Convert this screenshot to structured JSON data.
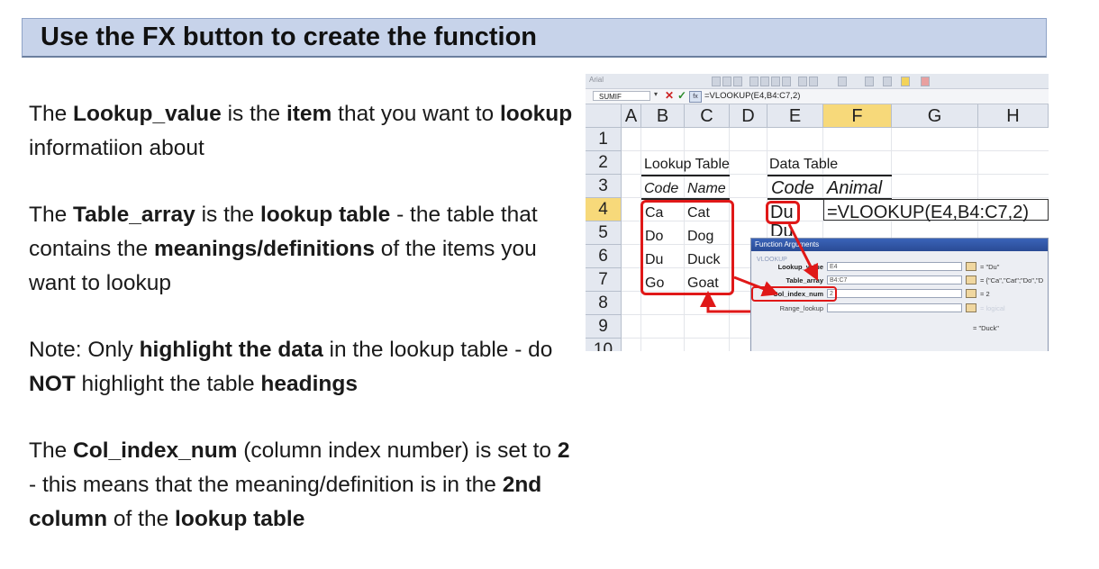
{
  "title": "Use the FX button to create the function",
  "paragraphs": [
    [
      {
        "t": "The ",
        "b": false
      },
      {
        "t": "Lookup_value",
        "b": true
      },
      {
        "t": " is the ",
        "b": false
      },
      {
        "t": "item",
        "b": true
      },
      {
        "t": " that you want to ",
        "b": false
      },
      {
        "t": "lookup",
        "b": true
      },
      {
        "t": " informatiion about",
        "b": false
      }
    ],
    [
      {
        "t": "The ",
        "b": false
      },
      {
        "t": "Table_array",
        "b": true
      },
      {
        "t": " is the ",
        "b": false
      },
      {
        "t": "lookup table",
        "b": true
      },
      {
        "t": " - the table that contains the ",
        "b": false
      },
      {
        "t": "meanings/definitions",
        "b": true
      },
      {
        "t": " of the items you want to lookup",
        "b": false
      }
    ],
    [
      {
        "t": "Note: Only ",
        "b": false
      },
      {
        "t": "highlight the data",
        "b": true
      },
      {
        "t": " in the lookup table - do ",
        "b": false
      },
      {
        "t": "NOT",
        "b": true
      },
      {
        "t": " highlight the table ",
        "b": false
      },
      {
        "t": "headings",
        "b": true
      }
    ],
    [
      {
        "t": "The ",
        "b": false
      },
      {
        "t": "Col_index_num",
        "b": true
      },
      {
        "t": " (column index number) is set to ",
        "b": false
      },
      {
        "t": "2",
        "b": true
      },
      {
        "t": " - this means that the meaning/definition is in the ",
        "b": false
      },
      {
        "t": "2nd column",
        "b": true
      },
      {
        "t": " of the ",
        "b": false
      },
      {
        "t": "lookup table",
        "b": true
      }
    ]
  ],
  "excel": {
    "font_name": "Arial",
    "name_box": "SUMIF",
    "formula_bar": "=VLOOKUP(E4,B4:C7,2)",
    "fx_label": "fx",
    "columns": [
      "A",
      "B",
      "C",
      "D",
      "E",
      "F",
      "G",
      "H"
    ],
    "rows": [
      "1",
      "2",
      "3",
      "4",
      "5",
      "6",
      "7",
      "8",
      "9",
      "10"
    ],
    "lookup_table_title": "Lookup Table",
    "lookup_headers": [
      "Code",
      "Name"
    ],
    "lookup_codes": [
      "Ca",
      "Do",
      "Du",
      "Go"
    ],
    "lookup_names": [
      "Cat",
      "Dog",
      "Duck",
      "Goat"
    ],
    "data_table_title": "Data Table",
    "data_headers": [
      "Code",
      "Animal"
    ],
    "data_code": "Du",
    "data_code_partial": "Du",
    "cell_formula": "=VLOOKUP(E4,B4:C7,2)",
    "dialog": {
      "title": "Function Arguments",
      "group": "VLOOKUP",
      "args": [
        {
          "label": "Lookup_value",
          "value": "E4",
          "result": "= \"Du\""
        },
        {
          "label": "Table_array",
          "value": "B4:C7",
          "result": "= {\"Ca\",\"Cat\";\"Do\",\"D"
        },
        {
          "label": "Col_index_num",
          "value": "2",
          "result": "= 2"
        },
        {
          "label": "Range_lookup",
          "value": "",
          "result": "= logical"
        }
      ],
      "final_result": "= \"Duck\""
    }
  }
}
